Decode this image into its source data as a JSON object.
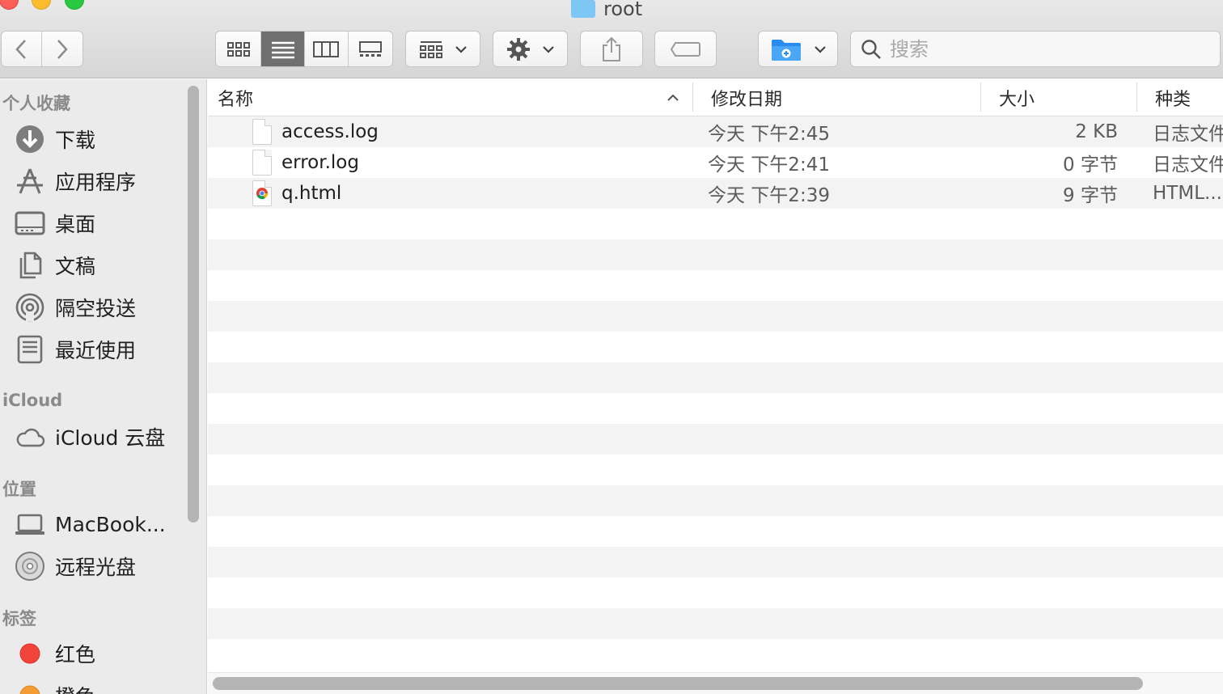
{
  "window": {
    "title": "root"
  },
  "toolbar": {
    "search_placeholder": "搜索"
  },
  "sidebar": {
    "sections": [
      {
        "label": "个人收藏",
        "items": [
          {
            "label": "下载",
            "icon": "download-icon"
          },
          {
            "label": "应用程序",
            "icon": "applications-icon"
          },
          {
            "label": "桌面",
            "icon": "desktop-icon"
          },
          {
            "label": "文稿",
            "icon": "documents-icon"
          },
          {
            "label": "隔空投送",
            "icon": "airdrop-icon"
          },
          {
            "label": "最近使用",
            "icon": "recents-icon"
          }
        ]
      },
      {
        "label": "iCloud",
        "items": [
          {
            "label": "iCloud 云盘",
            "icon": "cloud-icon"
          }
        ]
      },
      {
        "label": "位置",
        "items": [
          {
            "label": "MacBook...",
            "icon": "laptop-icon"
          },
          {
            "label": "远程光盘",
            "icon": "disc-icon"
          }
        ]
      },
      {
        "label": "标签",
        "items": [
          {
            "label": "红色",
            "icon": "tag-red-icon",
            "color": "#f1453c"
          },
          {
            "label": "橙色",
            "icon": "tag-orange-icon",
            "color": "#f59b33"
          }
        ]
      }
    ]
  },
  "list": {
    "columns": {
      "name": "名称",
      "date": "修改日期",
      "size": "大小",
      "kind": "种类"
    },
    "files": [
      {
        "name": "access.log",
        "date": "今天 下午2:45",
        "size": "2 KB",
        "kind": "日志文件",
        "icon": "document-icon"
      },
      {
        "name": "error.log",
        "date": "今天 下午2:41",
        "size": "0 字节",
        "kind": "日志文件",
        "icon": "document-icon"
      },
      {
        "name": "q.html",
        "date": "今天 下午2:39",
        "size": "9 字节",
        "kind": "HTML...",
        "icon": "chrome-document-icon"
      }
    ]
  },
  "colors": {
    "accent": "#2a8cf0",
    "folder": "#7ec6f3"
  }
}
